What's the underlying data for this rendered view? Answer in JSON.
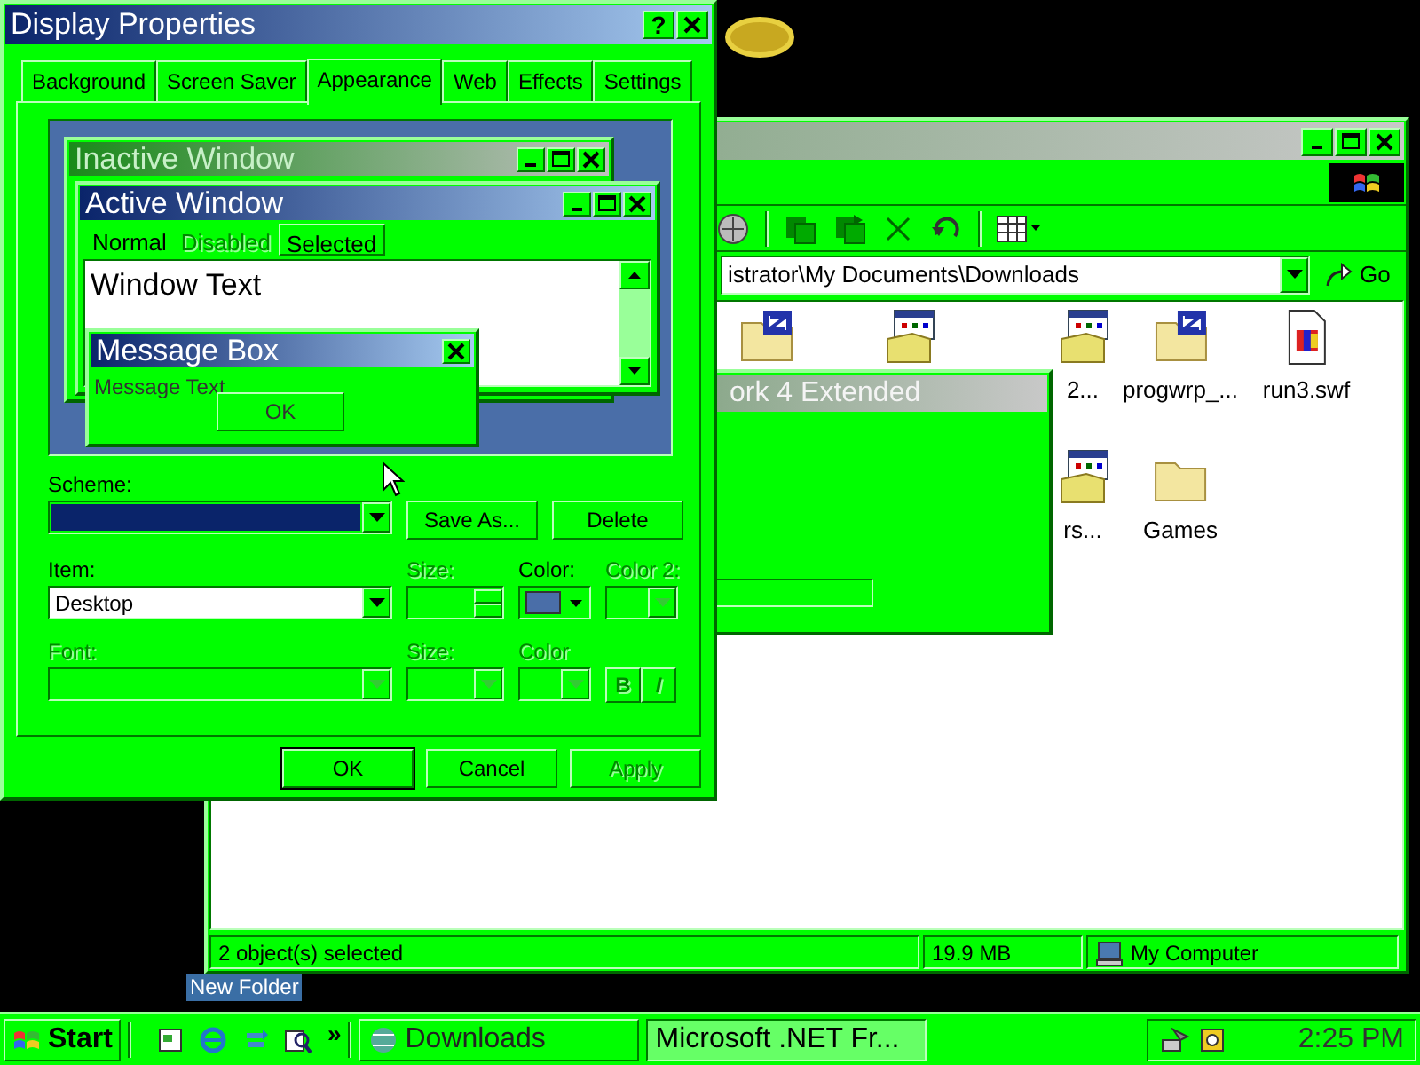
{
  "desktop": {
    "icon_label": "New Folder"
  },
  "explorer": {
    "address": "istrator\\My Documents\\Downloads",
    "go": "Go",
    "files": [
      {
        "kind": "zip"
      },
      {
        "kind": "installer"
      },
      {
        "kind": "installer",
        "label": "2..."
      },
      {
        "kind": "zip",
        "label": "progwrp_..."
      },
      {
        "kind": "flash",
        "label": "run3.swf"
      },
      {
        "kind": "installer",
        "label": "rs..."
      },
      {
        "kind": "folder",
        "label": "Games"
      }
    ],
    "status_bar": [
      "2 object(s) selected",
      "19.9 MB",
      "My Computer"
    ]
  },
  "net_window": {
    "title": "ork 4 Extended"
  },
  "dialog": {
    "title": "Display Properties",
    "help_button": "?",
    "tabs": [
      {
        "label": "Background",
        "selected": false
      },
      {
        "label": "Screen Saver",
        "selected": false
      },
      {
        "label": "Appearance",
        "selected": true
      },
      {
        "label": "Web",
        "selected": false
      },
      {
        "label": "Effects",
        "selected": false
      },
      {
        "label": "Settings",
        "selected": false
      }
    ],
    "preview": {
      "inactive_title": "Inactive Window",
      "active_title": "Active Window",
      "menu": [
        {
          "label": "Normal",
          "disabled": false,
          "selected": false
        },
        {
          "label": "Disabled",
          "disabled": true,
          "selected": false
        },
        {
          "label": "Selected",
          "disabled": false,
          "selected": true
        }
      ],
      "window_text": "Window Text",
      "message_title": "Message Box",
      "message_text": "Message Text",
      "ok": "OK"
    },
    "scheme": {
      "label": "Scheme:",
      "buttons": [
        {
          "label": "Save As...",
          "disabled": false
        },
        {
          "label": "Delete",
          "disabled": false
        }
      ]
    },
    "item_row": [
      {
        "label": "Item:",
        "value": "Desktop",
        "disabled": false
      },
      {
        "label": "Size:",
        "disabled": true
      },
      {
        "label": "Color:",
        "disabled": false
      },
      {
        "label": "Color 2:",
        "disabled": true
      }
    ],
    "font_row": [
      {
        "label": "Font:",
        "disabled": true
      },
      {
        "label": "Size:",
        "disabled": true
      },
      {
        "label": "Color",
        "disabled": true
      }
    ],
    "style_buttons": [
      {
        "label": "B",
        "disabled": true
      },
      {
        "label": "I",
        "disabled": true
      }
    ],
    "buttons": [
      {
        "label": "OK",
        "disabled": false
      },
      {
        "label": "Cancel",
        "disabled": false
      },
      {
        "label": "Apply",
        "disabled": true
      }
    ]
  },
  "taskbar": {
    "start": "Start",
    "chevron": "»",
    "tasks": [
      {
        "label": "Downloads",
        "selected": false
      },
      {
        "label": "Microsoft .NET Fr...",
        "selected": true
      }
    ],
    "clock": "2:25 PM"
  }
}
